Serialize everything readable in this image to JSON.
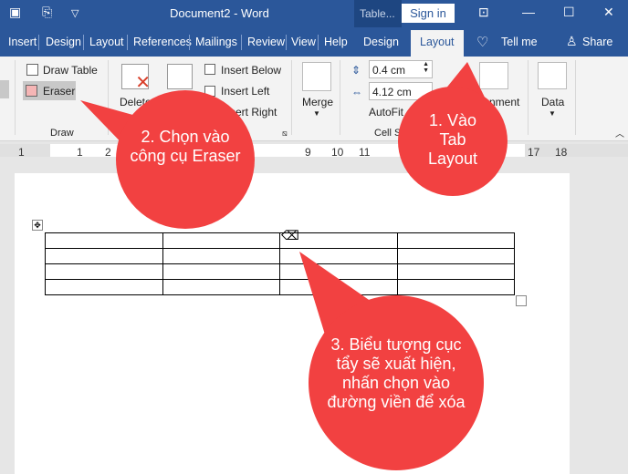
{
  "title_bar": {
    "document": "Document2  -  Word",
    "context": "Table...",
    "sign_in": "Sign in"
  },
  "tabs": [
    "Insert",
    "Design",
    "Layout",
    "References",
    "Mailings",
    "Review",
    "View",
    "Help",
    "Design",
    "Layout"
  ],
  "tell_me": "Tell me",
  "share": "Share",
  "ribbon": {
    "draw_table": "Draw Table",
    "eraser": "Eraser",
    "draw_group": "Draw",
    "delete": "Delete",
    "insert_below": "Insert Below",
    "insert_left": "Insert Left",
    "insert_right": "Insert Right",
    "merge": "Merge",
    "height": "0.4 cm",
    "width": "4.12 cm",
    "autofit": "AutoFit",
    "cell_size_group": "Cell Size",
    "alignment": "Alignment",
    "data": "Data"
  },
  "ruler": [
    "1",
    "1",
    "2",
    "9",
    "10",
    "11",
    "17",
    "18"
  ],
  "callouts": {
    "c1": "1. Vào Tab Layout",
    "c2": "2. Chọn vào công cụ Eraser",
    "c3": "3. Biểu tượng cục tẩy sẽ xuất hiện, nhấn chọn vào đường viền để xóa"
  },
  "colors": {
    "brand": "#2b579a",
    "callout": "#f24141"
  }
}
